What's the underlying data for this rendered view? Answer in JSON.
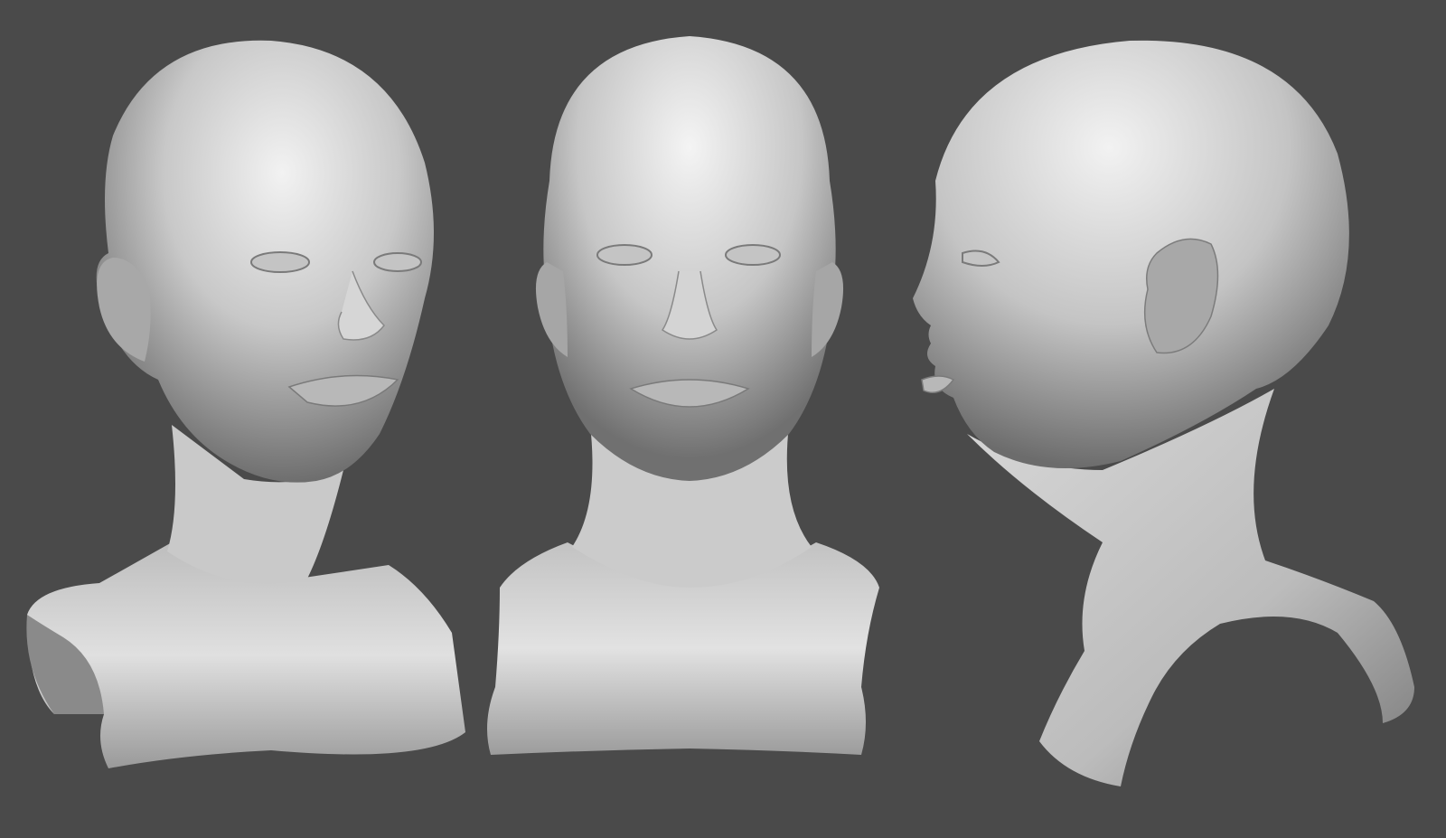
{
  "scene": {
    "description_hidden": "",
    "background_color": "#4a4a4a",
    "material_light": "#e6e6e6",
    "material_mid": "#b4b4b4",
    "material_dark": "#6a6a6a",
    "views": [
      {
        "id": "three-quarter",
        "icon": "sculpt-bust-three-quarter"
      },
      {
        "id": "front",
        "icon": "sculpt-bust-front"
      },
      {
        "id": "profile",
        "icon": "sculpt-bust-profile"
      }
    ]
  }
}
